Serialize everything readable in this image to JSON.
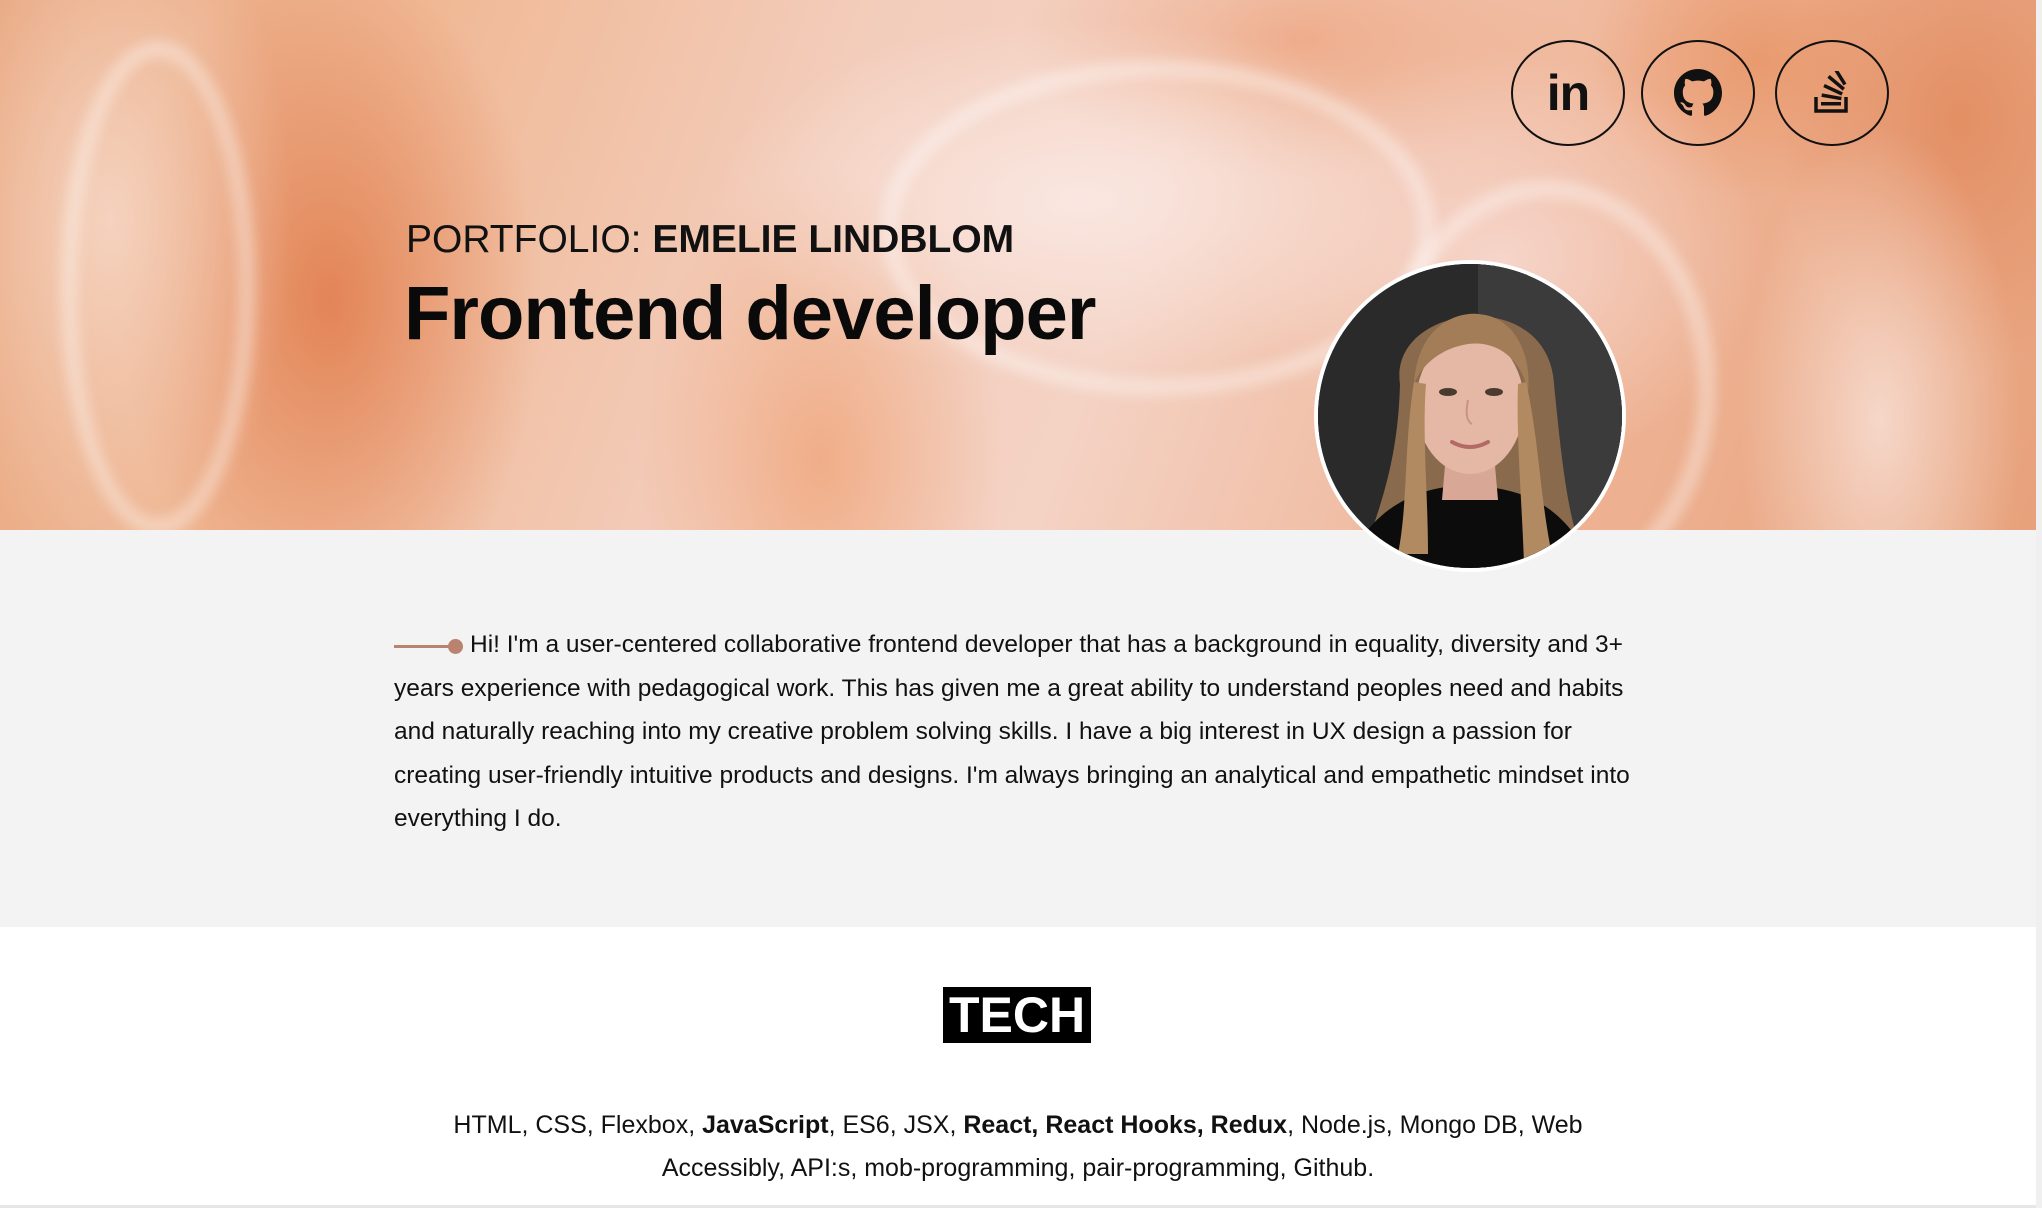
{
  "header": {
    "subtitle_prefix": "PORTFOLIO: ",
    "subtitle_name": "EMELIE LINDBLOM",
    "title": "Frontend developer"
  },
  "social": [
    {
      "name": "linkedin",
      "label": "in",
      "icon": "linkedin-icon"
    },
    {
      "name": "github",
      "icon": "github-icon"
    },
    {
      "name": "stackoverflow",
      "icon": "stackoverflow-icon"
    }
  ],
  "intro": {
    "text": "Hi! I'm a user-centered collaborative frontend developer that has a background in equality, diversity and 3+ years experience with pedagogical work. This has given me a great ability to understand peoples need and habits and naturally reaching into my creative problem solving skills. I have a big interest in UX design a passion for creating user-friendly intuitive products and designs. I'm always bringing an analytical and empathetic mindset into everything I do."
  },
  "tech": {
    "heading": "TECH",
    "parts": [
      {
        "text": "HTML, CSS, Flexbox, ",
        "bold": false
      },
      {
        "text": "JavaScript",
        "bold": true
      },
      {
        "text": ", ES6, JSX, ",
        "bold": false
      },
      {
        "text": "React, React Hooks, Redux",
        "bold": true
      },
      {
        "text": ", Node.js, Mongo DB, Web Accessibly, API:s, mob-programming, pair-programming, Github.",
        "bold": false
      }
    ]
  },
  "colors": {
    "accent": "#b98370",
    "intro_bg": "#f3f3f3",
    "hero_orange": "#e7a27c"
  }
}
